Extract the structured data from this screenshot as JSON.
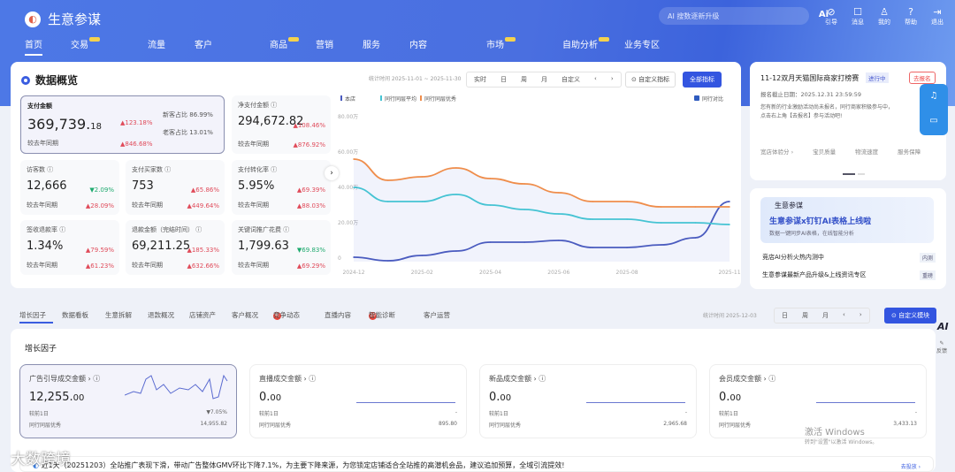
{
  "app": {
    "title": "生意参谋"
  },
  "nav": [
    "首页",
    "交易",
    "流量",
    "客户",
    "商品",
    "营销",
    "服务",
    "内容",
    "市场",
    "自助分析",
    "业务专区"
  ],
  "search": {
    "placeholder": "AI 搜数逐新升级",
    "ai": "Ai"
  },
  "tools": [
    "引导",
    "消息",
    "我的",
    "帮助",
    "退出"
  ],
  "overview": {
    "title": "数据概览",
    "stat_time": "统计时间 2025-11-01 ~ 2025-11-30",
    "periods": [
      "实时",
      "日",
      "周",
      "月",
      "自定义",
      "‹",
      "›"
    ],
    "custom_btn": "⊙ 自定义指标",
    "all_btn": "全部指标",
    "hero": {
      "label": "支付金额",
      "value": "369,739.",
      "dec": "18",
      "chg": "▲123.18%",
      "yoy_label": "较去年同期",
      "yoy": "▲846.68%",
      "new_label": "新客占比",
      "new": "86.99%",
      "old_label": "老客占比",
      "old": "13.01%"
    },
    "net": {
      "label": "净支付金额 ⓘ",
      "value": "294,672.82",
      "chg": "▲108.46%",
      "yoy_label": "较去年同期",
      "yoy": "▲876.92%"
    },
    "metrics": [
      {
        "label": "访客数 ⓘ",
        "value": "12,666",
        "chg": "▼2.09%",
        "dir": "dn",
        "yoy_label": "较去年同期",
        "yoy": "▲28.09%"
      },
      {
        "label": "支付买家数 ⓘ",
        "value": "753",
        "chg": "▲65.86%",
        "dir": "up",
        "yoy_label": "较去年同期",
        "yoy": "▲449.64%"
      },
      {
        "label": "支付转化率 ⓘ",
        "value": "5.95%",
        "chg": "▲69.39%",
        "dir": "up",
        "yoy_label": "较去年同期",
        "yoy": "▲88.03%"
      },
      {
        "label": "签收退款率 ⓘ",
        "value": "1.34%",
        "chg": "▲79.59%",
        "dir": "up",
        "yoy_label": "较去年同期",
        "yoy": "▲61.23%"
      },
      {
        "label": "退款金额（完结时间） ⓘ",
        "value": "69,211.25",
        "chg": "▲185.33%",
        "dir": "up",
        "yoy_label": "较去年同期",
        "yoy": "▲632.66%"
      },
      {
        "label": "关键词推广花费 ⓘ",
        "value": "1,799.63",
        "chg": "▼69.83%",
        "dir": "dn",
        "yoy_label": "较去年同期",
        "yoy": "▲69.29%"
      }
    ]
  },
  "chart_data": {
    "type": "line",
    "legend": [
      "本店",
      "同行同层平均",
      "同行同层优秀"
    ],
    "compare_toggle": "同行对比",
    "x": [
      "2024-12",
      "2025-01",
      "2025-02",
      "2025-03",
      "2025-04",
      "2025-05",
      "2025-06",
      "2025-07",
      "2025-08",
      "2025-09",
      "2025-10",
      "2025-11"
    ],
    "xticks": [
      "2024-12",
      "2025-02",
      "2025-04",
      "2025-06",
      "2025-08",
      "2025-11"
    ],
    "yticks": [
      "0",
      "20.00万",
      "40.00万",
      "60.00万",
      "80.00万"
    ],
    "ylim": [
      0,
      80
    ],
    "yunit": "万",
    "series": [
      {
        "name": "本店",
        "color": "#4a5bbf",
        "values": [
          2.5,
          0.5,
          3.5,
          6,
          11,
          11,
          12,
          8,
          8,
          9.5,
          13.5,
          34
        ]
      },
      {
        "name": "同行同层平均",
        "color": "#45c3d3",
        "values": [
          42,
          34,
          34,
          38,
          32,
          29.5,
          27,
          24,
          24,
          22,
          22,
          21
        ]
      },
      {
        "name": "同行同层优秀",
        "color": "#ef8d4b",
        "values": [
          58,
          46,
          48,
          53,
          47,
          44,
          39,
          34,
          34,
          31,
          31,
          31
        ]
      }
    ]
  },
  "promo": {
    "title": "11-12双月天猫国际商家打榜赛",
    "status": "进行中",
    "btn": "去报名",
    "deadline": "报名截止日期：2025.12.31 23:59:59",
    "desc1": "您有新的行业激励活动尚未报名，同行商家积极参与中，",
    "desc2": "点击右上角【去报名】参与活动吧!",
    "links": [
      "宽店体验分 ›",
      "宝贝质量",
      "物流速度",
      "服务保障"
    ]
  },
  "news": {
    "brand": "生意参谋",
    "banner_title": "生意参谋x钉钉AI表格上线啦",
    "banner_sub": "数据一键同步AI表格，在线智能分析",
    "items": [
      {
        "text": "竞店AI分析火热内测中",
        "tag": "内测"
      },
      {
        "text": "生意参谋最新产品升级&上线资讯专区",
        "tag": "重磅"
      }
    ]
  },
  "tabs": [
    {
      "label": "增长因子"
    },
    {
      "label": "数据看板"
    },
    {
      "label": "生意拆解"
    },
    {
      "label": "退款概况"
    },
    {
      "label": "店铺资产"
    },
    {
      "label": "客户概况"
    },
    {
      "label": "竞争动态",
      "badge": "新"
    },
    {
      "label": "直播内容"
    },
    {
      "label": "智能诊断",
      "badge": "20"
    },
    {
      "label": "客户运营"
    }
  ],
  "tabbar": {
    "stat_time": "统计时间 2025-12-03",
    "periods": [
      "日",
      "周",
      "月",
      "‹",
      "›"
    ],
    "custom_btn": "⊙ 自定义模块",
    "ai": "AI",
    "feedback": "反馈"
  },
  "growth": {
    "title": "增长因子",
    "cards": [
      {
        "label": "广告引导成交金额 › ⓘ",
        "value": "12,255.",
        "dec": "00",
        "cmp_label": "较前1日",
        "cmp": "▼7.05%",
        "peer_label": "同行同层优秀",
        "peer": "14,955.82"
      },
      {
        "label": "直播成交金额 › ⓘ",
        "value": "0.",
        "dec": "00",
        "cmp_label": "较前1日",
        "cmp": "-",
        "peer_label": "同行同层优秀",
        "peer": "895.80"
      },
      {
        "label": "新品成交金额 › ⓘ",
        "value": "0.",
        "dec": "00",
        "cmp_label": "较前1日",
        "cmp": "-",
        "peer_label": "同行同层优秀",
        "peer": "2,965.68"
      },
      {
        "label": "会员成交金额 › ⓘ",
        "value": "0.",
        "dec": "00",
        "cmp_label": "较前1日",
        "cmp": "-",
        "peer_label": "同行同层优秀",
        "peer": "3,433.13"
      }
    ]
  },
  "tip": {
    "text": "近1天（20251203）全站推广表现下滑，带动广告整体GMV环比下降7.1%，为主要下降来源，为您锁定店铺适合全站推的高潜机会品，建议追加预算，全域引流提效!",
    "link": "去投放 ›"
  },
  "watermarks": {
    "corner": "大数跨境",
    "windows1": "激活 Windows",
    "windows2": "转到\"设置\"以激活 Windows。"
  }
}
